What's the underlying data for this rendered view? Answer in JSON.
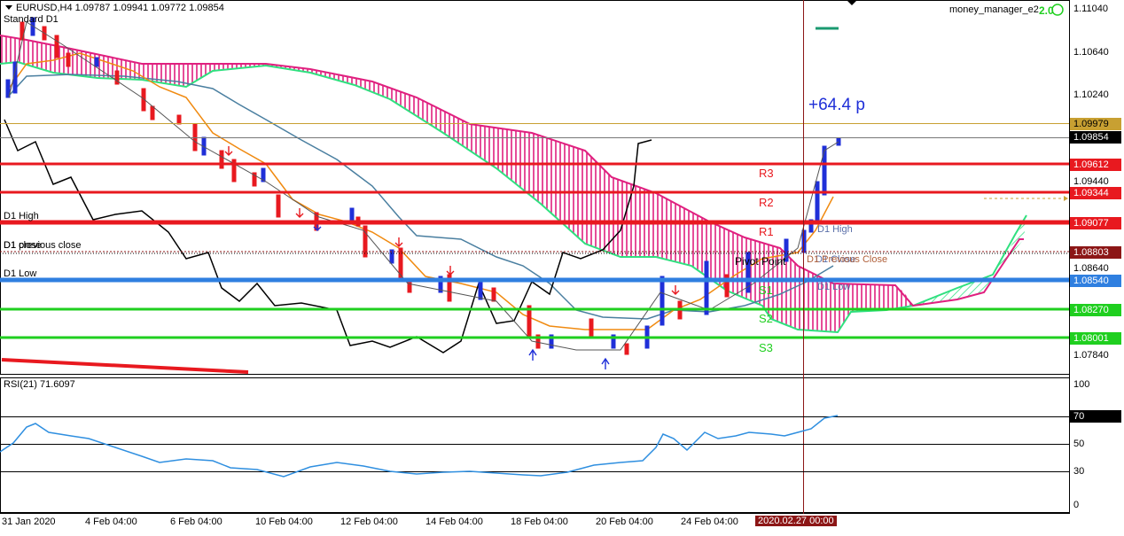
{
  "window": {
    "symbol_line": "EURUSD,H4  1.09787 1.09941 1.09772 1.09854",
    "indicator_label": "Standard D1",
    "ea_label": "money_manager_e2",
    "ea_badge": "2.0"
  },
  "profit_label": "+64.4 p",
  "price_axis": {
    "ticks": [
      "1.11040",
      "1.10640",
      "1.10240",
      "1.09440",
      "1.08640",
      "1.07840"
    ],
    "tags": [
      {
        "name": "tag-d1-previous-close",
        "text": "1.09979",
        "color": "#c8a032"
      },
      {
        "name": "tag-current-price",
        "text": "1.09854",
        "color": "#000000"
      },
      {
        "name": "tag-r3",
        "text": "1.09612",
        "color": "#e8191f"
      },
      {
        "name": "tag-r2",
        "text": "1.09344",
        "color": "#e8191f"
      },
      {
        "name": "tag-r1",
        "text": "1.09077",
        "color": "#e8191f"
      },
      {
        "name": "tag-pivot",
        "text": "1.08803",
        "color": "#8c1616"
      },
      {
        "name": "tag-s1",
        "text": "1.08540",
        "color": "#2f7fe0"
      },
      {
        "name": "tag-s2",
        "text": "1.08270",
        "color": "#1fcf1f"
      },
      {
        "name": "tag-s3",
        "text": "1.08001",
        "color": "#1fcf1f"
      }
    ]
  },
  "levels": {
    "r3": "R3",
    "r2": "R2",
    "r1": "R1",
    "s1": "S1",
    "s2": "S2",
    "s3": "S3",
    "pivot_point": "Pivot Point",
    "d1_high_left": "D1 High",
    "d1_low_left": "D1 Low",
    "d1_close_left": "D1 close",
    "d1_prev_close_left": "D1 previous close",
    "d1_high_right": "D1 High",
    "d1_low_right": "D1 Low",
    "d1_close_right": "D1 Close",
    "d1_prev_close_right": "D1 Previous Close"
  },
  "rsi": {
    "label": "RSI(21) 71.6097",
    "ticks": [
      "100",
      "70",
      "50",
      "30",
      "0"
    ]
  },
  "time_axis": {
    "labels": [
      "31 Jan 2020",
      "4 Feb 04:00",
      "6 Feb 04:00",
      "10 Feb 04:00",
      "12 Feb 04:00",
      "14 Feb 04:00",
      "18 Feb 04:00",
      "20 Feb 04:00",
      "24 Feb 04:00"
    ],
    "highlight": "2020.02.27 00:00"
  },
  "colors": {
    "resistance": "#e8191f",
    "support": "#1fcf1f",
    "s1": "#2f7fe0",
    "bull_candle": "#1f2fd8",
    "bear_candle": "#e8191f",
    "cloud_bear": "#e0207f",
    "cloud_bull": "#2fe07f",
    "tenkan": "#f08a10",
    "kijun": "#4a7fa0",
    "rsi_line": "#2f8fe0",
    "highlight_bg": "#8c1616"
  }
}
